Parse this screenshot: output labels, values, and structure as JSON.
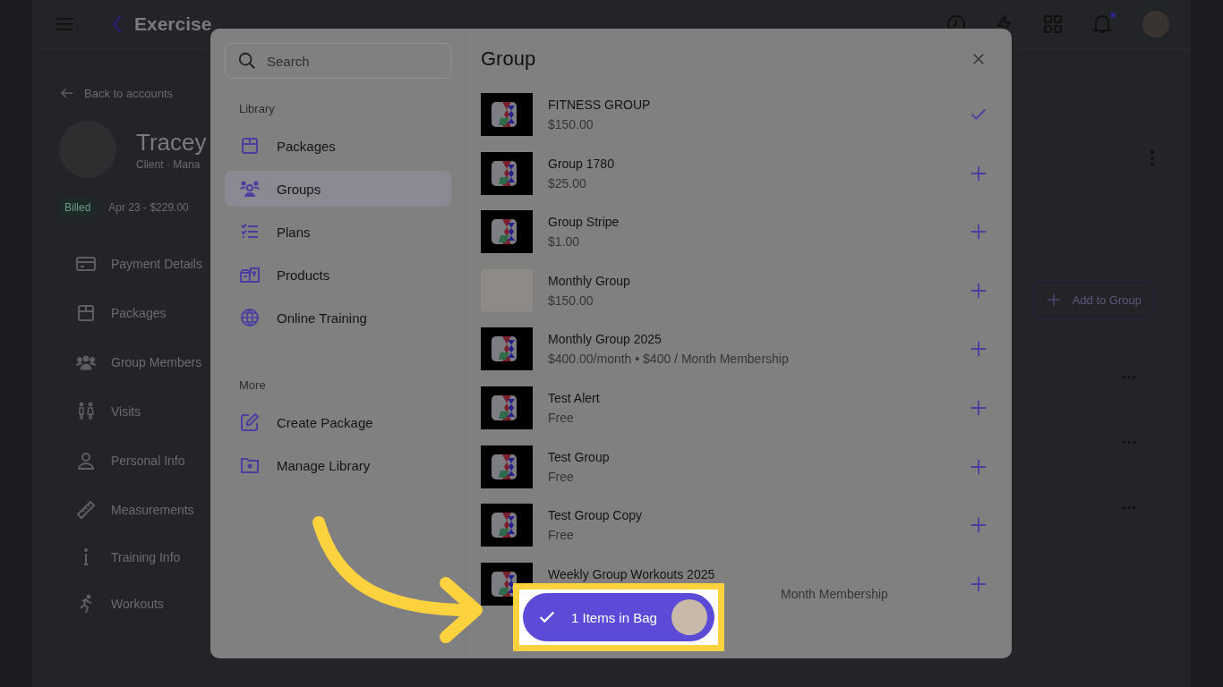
{
  "header": {
    "brand": "Exercise"
  },
  "back_link": "Back to accounts",
  "client": {
    "name": "Tracey",
    "subtitle": "Client · Mana",
    "status": "Billed",
    "billing": "Apr 23 - $229.00"
  },
  "client_menu": [
    {
      "label": "Payment Details",
      "kind": "card"
    },
    {
      "label": "Packages",
      "kind": "package"
    },
    {
      "label": "Group Members",
      "kind": "group"
    },
    {
      "label": "Visits",
      "kind": "visits"
    },
    {
      "label": "Personal Info",
      "kind": "person"
    },
    {
      "label": "Measurements",
      "kind": "ruler"
    },
    {
      "label": "Training Info",
      "kind": "info"
    },
    {
      "label": "Workouts",
      "kind": "run"
    }
  ],
  "add_button": "Add to Group",
  "modal": {
    "search": {
      "placeholder": "Search"
    },
    "sections": [
      {
        "heading": "Library",
        "items": [
          {
            "label": "Packages",
            "kind": "package",
            "selected": false
          },
          {
            "label": "Groups",
            "kind": "group",
            "selected": true
          },
          {
            "label": "Plans",
            "kind": "list",
            "selected": false
          },
          {
            "label": "Products",
            "kind": "products",
            "selected": false
          },
          {
            "label": "Online Training",
            "kind": "globe",
            "selected": false
          }
        ]
      },
      {
        "heading": "More",
        "items": [
          {
            "label": "Create Package",
            "kind": "edit",
            "selected": false
          },
          {
            "label": "Manage Library",
            "kind": "folder",
            "selected": false
          }
        ]
      }
    ],
    "title": "Group",
    "items": [
      {
        "name": "FITNESS GROUP",
        "price": "$150.00",
        "kind": "logo",
        "added": true
      },
      {
        "name": "Group 1780",
        "price": "$25.00",
        "kind": "logo",
        "added": false
      },
      {
        "name": "Group Stripe",
        "price": "$1.00",
        "kind": "logo",
        "added": false
      },
      {
        "name": "Monthly Group",
        "price": "$150.00",
        "kind": "photo",
        "added": false
      },
      {
        "name": "Monthly Group 2025",
        "price": "$400.00/month • $400 / Month Membership",
        "kind": "logo",
        "added": false
      },
      {
        "name": "Test Alert",
        "price": "Free",
        "kind": "logo",
        "added": false
      },
      {
        "name": "Test Group",
        "price": "Free",
        "kind": "logo",
        "added": false
      },
      {
        "name": "Test Group Copy",
        "price": "Free",
        "kind": "logo",
        "added": false
      },
      {
        "name": "Weekly Group Workouts 2025",
        "price": "Month Membership",
        "kind": "logo",
        "added": false
      }
    ],
    "bag": {
      "label": "1 Items in Bag"
    }
  }
}
